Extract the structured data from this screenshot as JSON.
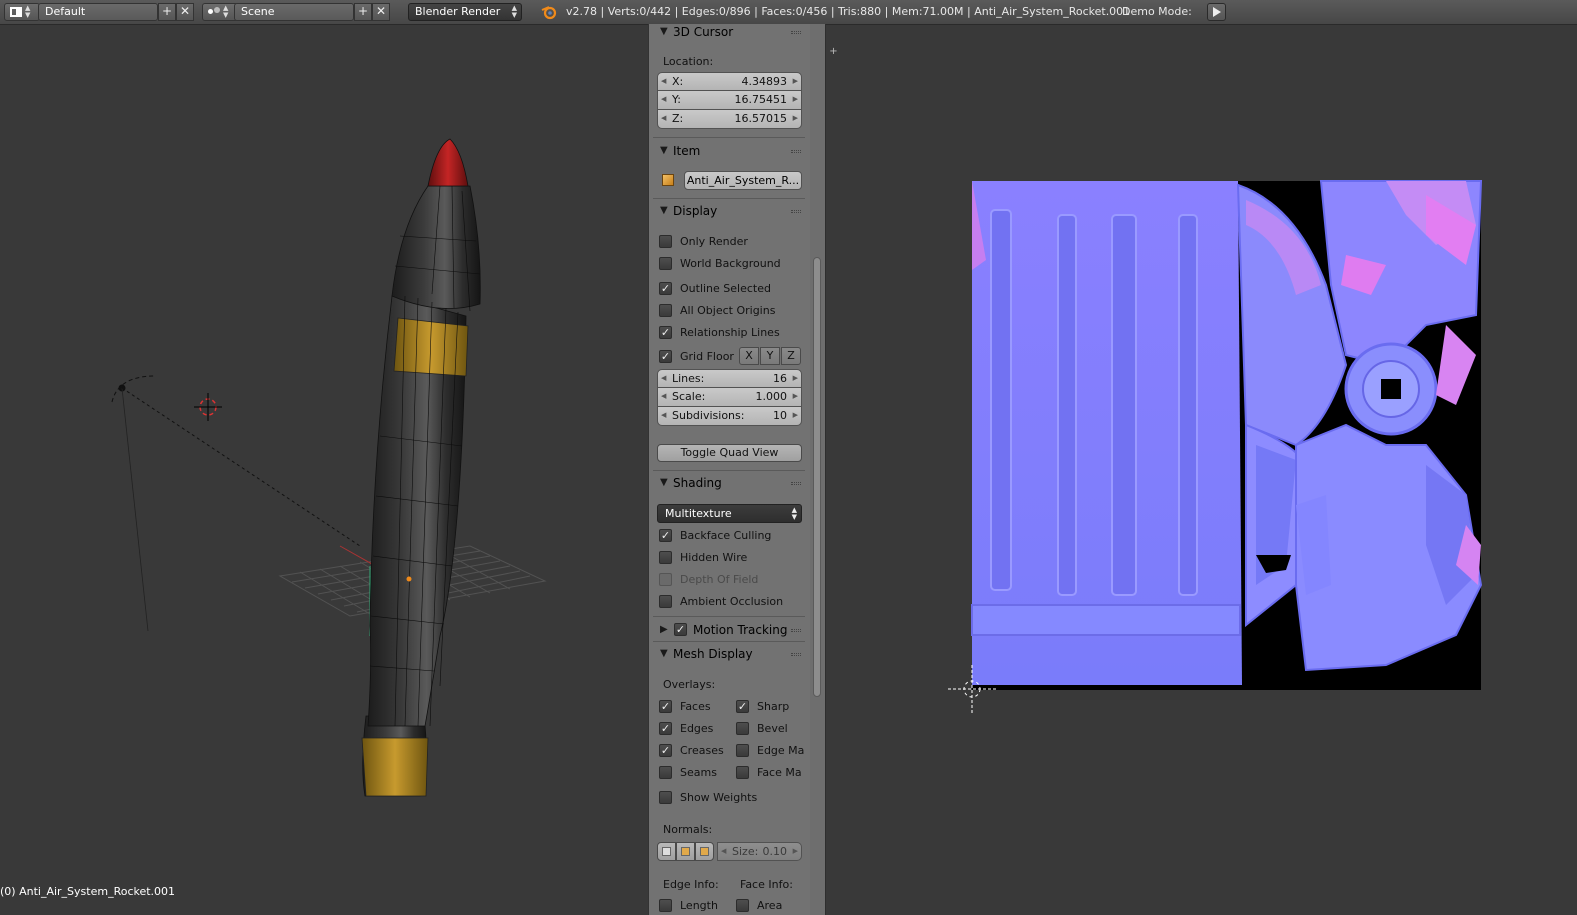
{
  "header": {
    "layout_name": "Default",
    "scene_name": "Scene",
    "render_engine": "Blender Render",
    "stats": "v2.78 | Verts:0/442 | Edges:0/896 | Faces:0/456 | Tris:880 | Mem:71.00M | Anti_Air_System_Rocket.001",
    "demo_mode_label": "Demo Mode:"
  },
  "viewport": {
    "object_label": "(0) Anti_Air_System_Rocket.001"
  },
  "npanel": {
    "cursor": {
      "title": "3D Cursor",
      "location_label": "Location:",
      "x_label": "X:",
      "x_value": "4.34893",
      "y_label": "Y:",
      "y_value": "16.75451",
      "z_label": "Z:",
      "z_value": "16.57015"
    },
    "item": {
      "title": "Item",
      "name_value": "Anti_Air_System_R..."
    },
    "display": {
      "title": "Display",
      "only_render": "Only Render",
      "world_background": "World Background",
      "outline_selected": "Outline Selected",
      "all_object_origins": "All Object Origins",
      "relationship_lines": "Relationship Lines",
      "grid_floor": "Grid Floor",
      "axis_x": "X",
      "axis_y": "Y",
      "axis_z": "Z",
      "lines_label": "Lines:",
      "lines_value": "16",
      "scale_label": "Scale:",
      "scale_value": "1.000",
      "subdivisions_label": "Subdivisions:",
      "subdivisions_value": "10",
      "toggle_quad_view": "Toggle Quad View"
    },
    "shading": {
      "title": "Shading",
      "mode": "Multitexture",
      "backface_culling": "Backface Culling",
      "hidden_wire": "Hidden Wire",
      "depth_of_field": "Depth Of Field",
      "ambient_occlusion": "Ambient Occlusion"
    },
    "motion_tracking": {
      "title": "Motion Tracking"
    },
    "mesh_display": {
      "title": "Mesh Display",
      "overlays_label": "Overlays:",
      "faces": "Faces",
      "sharp": "Sharp",
      "edges": "Edges",
      "bevel": "Bevel",
      "creases": "Creases",
      "edge_marks": "Edge Ma",
      "seams": "Seams",
      "face_marks": "Face Ma",
      "show_weights": "Show Weights",
      "normals_label": "Normals:",
      "size_label": "Size:",
      "size_value": "0.10",
      "edge_info_label": "Edge Info:",
      "face_info_label": "Face Info:",
      "length": "Length",
      "area": "Area"
    }
  },
  "colors": {
    "normal_map_base": "#7f7fff",
    "rocket_tip": "#b11c1c",
    "rocket_band": "#b08a25",
    "rocket_body": "#2a2a2a"
  }
}
